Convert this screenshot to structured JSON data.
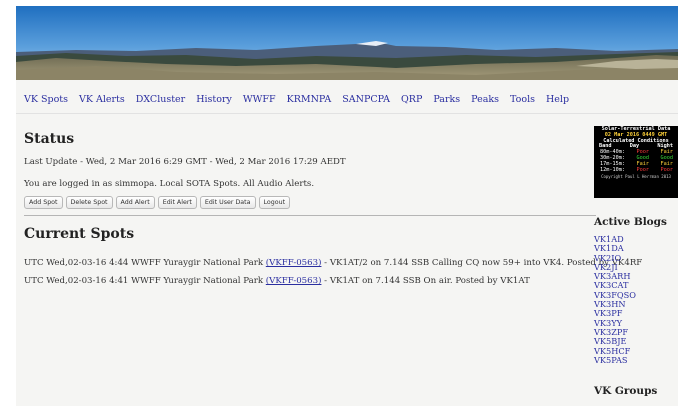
{
  "nav": {
    "items": [
      "VK Spots",
      "VK Alerts",
      "DXCluster",
      "History",
      "WWFF",
      "KRMNPA",
      "SANPCPA",
      "QRP",
      "Parks",
      "Peaks",
      "Tools",
      "Help"
    ]
  },
  "status": {
    "title": "Status",
    "last_update": "Last Update - Wed, 2 Mar 2016 6:29 GMT - Wed, 2 Mar 2016 17:29 AEDT",
    "logged_in": "You are logged in as simmopa. Local SOTA Spots. All Audio Alerts.",
    "buttons": [
      "Add Spot",
      "Delete Spot",
      "Add Alert",
      "Edit Alert",
      "Edit User Data",
      "Logout"
    ]
  },
  "spots": {
    "title": "Current Spots",
    "items": [
      {
        "prefix": "UTC Wed,02-03-16 4:44 WWFF Yuraygir National Park ",
        "ref": "(VKFF-0563)",
        "suffix": " - VK1AT/2 on 7.144 SSB Calling CQ now 59+ into VK4. Posted by VK4RF"
      },
      {
        "prefix": "UTC Wed,02-03-16 4:41 WWFF Yuraygir National Park ",
        "ref": "(VKFF-0563)",
        "suffix": " - VK1AT on 7.144 SSB On air. Posted by VK1AT"
      }
    ]
  },
  "solar": {
    "title": "Solar-Terrestrial Data",
    "date": "02 Mar 2016 0449 GMT",
    "subtitle": "Calculated Conditions",
    "headers": [
      "Band",
      "Day",
      "Night"
    ],
    "rows": [
      {
        "band": "80m-40m:",
        "day": "Poor",
        "night": "Fair"
      },
      {
        "band": "30m-20m:",
        "day": "Good",
        "night": "Good"
      },
      {
        "band": "17m-15m:",
        "day": "Fair",
        "night": "Fair"
      },
      {
        "band": "12m-10m:",
        "day": "Poor",
        "night": "Poor"
      }
    ],
    "copyright": "Copyright Paul L Herrman 2013",
    "colors": {
      "Poor": "#ff3a3a",
      "Fair": "#ffd23a",
      "Good": "#3adf3a"
    }
  },
  "sidebar": {
    "active_blogs_title": "Active Blogs",
    "blogs": [
      "VK1AD",
      "VK1DA",
      "VK2IO",
      "VK2JI",
      "VK3ARH",
      "VK3CAT",
      "VK3FQSO",
      "VK3HN",
      "VK3PF",
      "VK3YY",
      "VK3ZPF",
      "VK5BJE",
      "VK5HCF",
      "VK5PAS"
    ],
    "groups_title": "VK Groups"
  },
  "colors": {
    "link": "#2b2fa0",
    "page_bg": "#f5f5f3"
  }
}
